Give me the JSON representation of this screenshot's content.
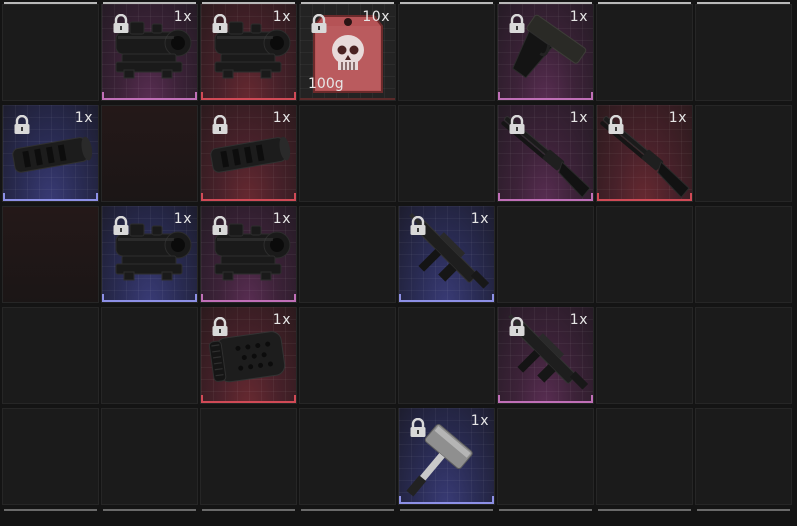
{
  "palette": {
    "purple": "#c06fb7",
    "red": "#d04a56",
    "blue": "#8d90e6",
    "background": "#1b1b1b"
  },
  "inventory": {
    "columns": 8,
    "rows": 5,
    "items": [
      {
        "id": "scope-purple-1",
        "col": 1,
        "row": 0,
        "rarity": "purple",
        "quantity": "1x",
        "locked": true,
        "icon": "rifle-scope-icon"
      },
      {
        "id": "scope-red-1",
        "col": 2,
        "row": 0,
        "rarity": "red",
        "quantity": "1x",
        "locked": true,
        "icon": "rifle-scope-icon"
      },
      {
        "id": "dog-tag",
        "col": 3,
        "row": 0,
        "rarity": "tag",
        "quantity": "10x",
        "weight": "100g",
        "locked": true,
        "icon": "skull-tag-icon"
      },
      {
        "id": "pistol-purple",
        "col": 5,
        "row": 0,
        "rarity": "purple",
        "quantity": "1x",
        "locked": true,
        "icon": "pistol-icon"
      },
      {
        "id": "muzzle-blue",
        "col": 0,
        "row": 1,
        "rarity": "blue",
        "quantity": "1x",
        "locked": true,
        "icon": "muzzle-brake-icon"
      },
      {
        "id": "muzzle-red",
        "col": 2,
        "row": 1,
        "rarity": "red",
        "quantity": "1x",
        "locked": true,
        "icon": "muzzle-brake-icon"
      },
      {
        "id": "shotgun-purple",
        "col": 5,
        "row": 1,
        "rarity": "purple",
        "quantity": "1x",
        "locked": true,
        "icon": "shotgun-icon"
      },
      {
        "id": "shotgun-red",
        "col": 6,
        "row": 1,
        "rarity": "red",
        "quantity": "1x",
        "locked": true,
        "icon": "shotgun-icon"
      },
      {
        "id": "scope-blue",
        "col": 1,
        "row": 2,
        "rarity": "blue",
        "quantity": "1x",
        "locked": true,
        "icon": "rifle-scope-icon"
      },
      {
        "id": "scope-purple-2",
        "col": 2,
        "row": 2,
        "rarity": "purple",
        "quantity": "1x",
        "locked": true,
        "icon": "rifle-scope-icon"
      },
      {
        "id": "smg-blue",
        "col": 4,
        "row": 2,
        "rarity": "blue",
        "quantity": "1x",
        "locked": true,
        "icon": "smg-icon"
      },
      {
        "id": "handguard-red",
        "col": 2,
        "row": 3,
        "rarity": "red",
        "quantity": "1x",
        "locked": true,
        "icon": "handguard-icon"
      },
      {
        "id": "smg-purple",
        "col": 5,
        "row": 3,
        "rarity": "purple",
        "quantity": "1x",
        "locked": true,
        "icon": "smg-icon"
      },
      {
        "id": "hammer-blue",
        "col": 4,
        "row": 4,
        "rarity": "blue",
        "quantity": "1x",
        "locked": true,
        "icon": "sledgehammer-icon"
      }
    ]
  }
}
